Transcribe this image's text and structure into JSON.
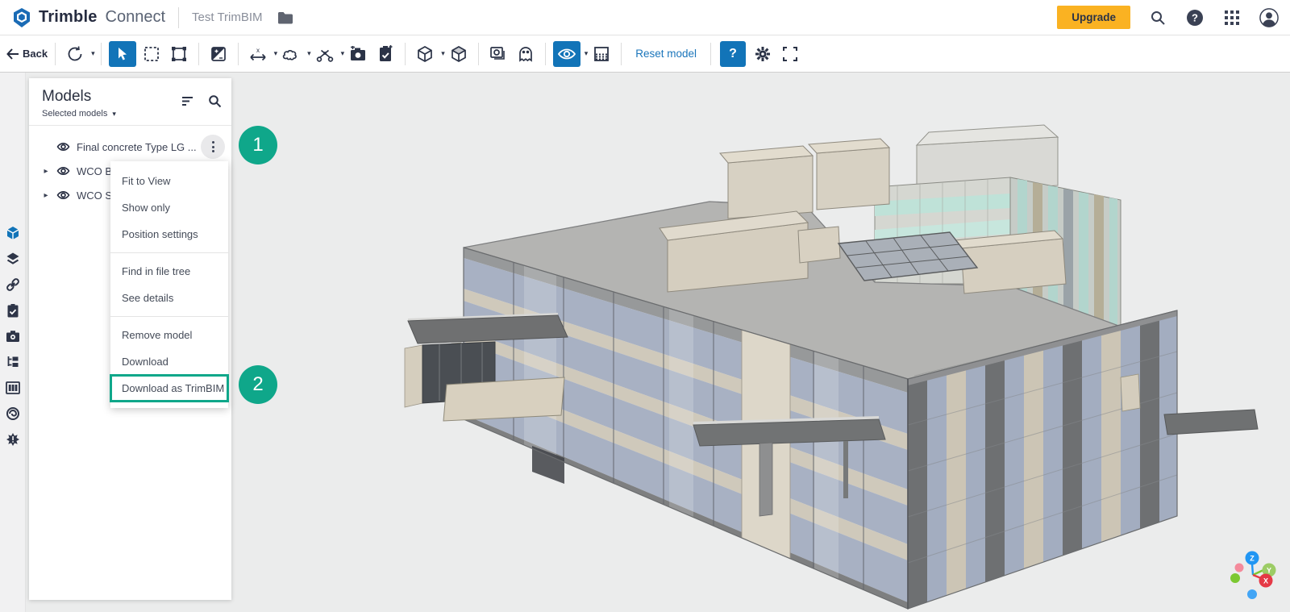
{
  "header": {
    "brand_bold": "Trimble",
    "brand_light": "Connect",
    "project_name": "Test TrimBIM",
    "upgrade_label": "Upgrade",
    "icons": [
      "trimble-logo",
      "folder-icon",
      "search-icon",
      "help-icon",
      "apps-grid-icon",
      "account-icon"
    ]
  },
  "toolbar": {
    "back_label": "Back",
    "reset_model_label": "Reset model",
    "help_label": "?",
    "tool_icons": [
      "orbit",
      "select-cursor",
      "marquee-select",
      "polygon-select",
      "contrast",
      "measure",
      "markup-cloud",
      "section-cut",
      "snapshot-camera",
      "clipboard-check",
      "cube-view",
      "shaded-box",
      "views",
      "ghost-mode",
      "visibility-eye",
      "hatch-grid",
      "settings-gear",
      "fullscreen"
    ]
  },
  "sidebar": {
    "icons": [
      "models-cube",
      "layers",
      "link",
      "todo-clipboard",
      "camera",
      "file-tree",
      "organizer-columns",
      "trimble-swirl",
      "issues-burst"
    ],
    "active": "models-cube"
  },
  "models_panel": {
    "title": "Models",
    "selected_models_label": "Selected models",
    "rows": [
      {
        "label": "Final concrete Type LG ...",
        "has_caret": false
      },
      {
        "label": "WCO B",
        "has_caret": true
      },
      {
        "label": "WCO S",
        "has_caret": true
      }
    ]
  },
  "context_menu": {
    "items": [
      {
        "label": "Fit to View"
      },
      {
        "label": "Show only"
      },
      {
        "label": "Position settings"
      },
      {
        "label": "Find in file tree"
      },
      {
        "label": "See details"
      },
      {
        "label": "Remove model"
      },
      {
        "label": "Download"
      },
      {
        "label": "Download as TrimBIM"
      }
    ],
    "highlighted_item": "Download as TrimBIM"
  },
  "annotations": {
    "badges": [
      {
        "number": "1"
      },
      {
        "number": "2"
      }
    ]
  },
  "axis_gizmo": {
    "x": "X",
    "y": "Y",
    "z": "Z"
  },
  "colors": {
    "accent_blue": "#1274b8",
    "brand_navy": "#252b3f",
    "step_teal": "#0fa78a",
    "upgrade_yellow": "#fab222",
    "link_blue": "#1a75bb",
    "canvas_gray": "#ebecec"
  }
}
